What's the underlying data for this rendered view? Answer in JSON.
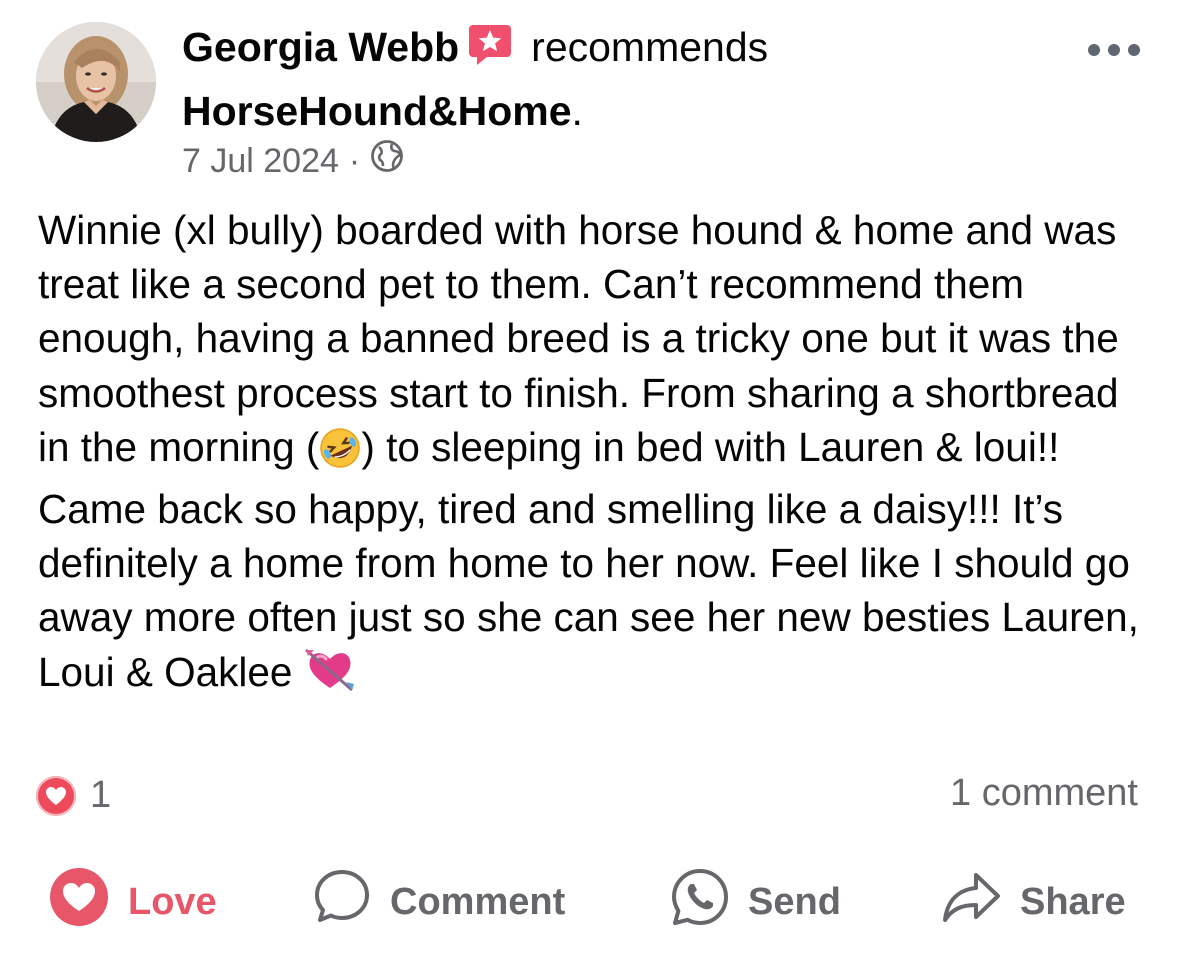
{
  "post": {
    "author": "Georgia Webb",
    "recommends_word": "recommends",
    "page_name": "HorseHound&Home",
    "page_suffix": ".",
    "date": "7 Jul 2024",
    "separator": "·",
    "privacy_icon": "globe-icon",
    "body_text_1": "Winnie (xl bully) boarded with horse hound & home and was treat like a second pet to them. Can’t recommend them enough, having a banned breed is a tricky one but it was the smoothest process start to finish. From sharing a shortbread in the morning (",
    "laugh_emoji": "rolling-on-floor-laughing-emoji",
    "body_text_2": ") to sleeping in bed with Lauren & loui!! Came back so happy, tired and smelling like a daisy!!! It’s definitely a home from home to her now. Feel like I should go away more often just so she can see her new besties Lauren, Loui & Oaklee ",
    "heart_emoji": "heart-with-arrow-emoji"
  },
  "stats": {
    "reaction_icon": "love-reaction-icon",
    "reaction_count": "1",
    "comment_count": "1 comment"
  },
  "actions": {
    "love": "Love",
    "comment": "Comment",
    "send": "Send",
    "share": "Share"
  },
  "colors": {
    "love_red": "#e8566a",
    "secondary_text": "#65676b",
    "recommend_badge": "#f0506e"
  }
}
